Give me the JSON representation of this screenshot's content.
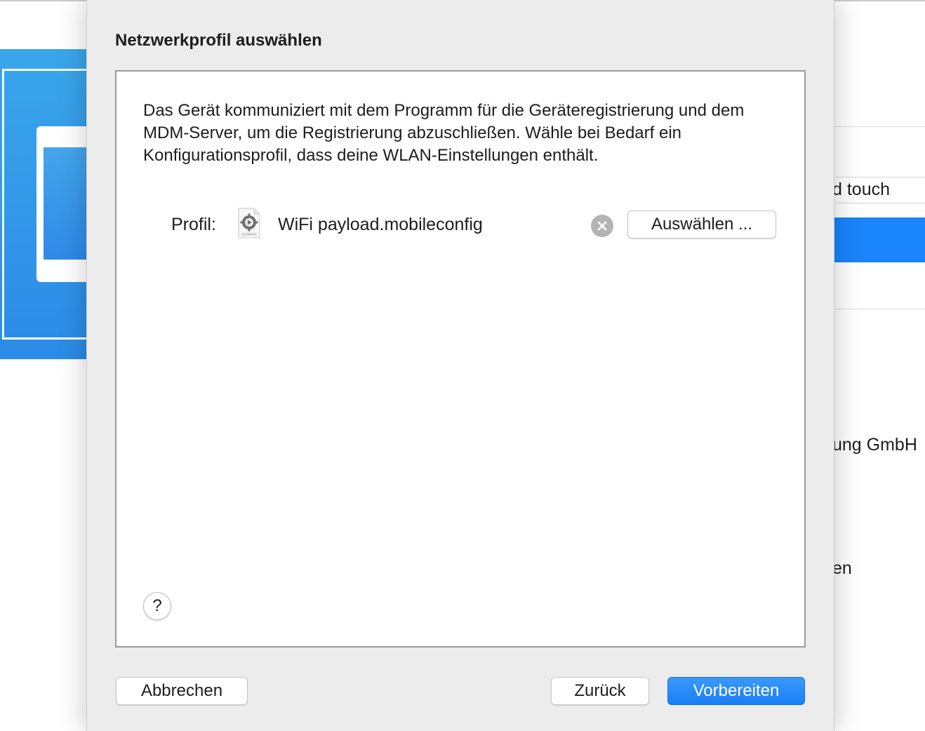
{
  "background": {
    "fragment_1": "d touch",
    "fragment_2": "ung GmbH",
    "fragment_3": "en"
  },
  "sheet": {
    "title": "Netzwerkprofil auswählen",
    "description": "Das Gerät kommuniziert mit dem Programm für die Geräteregistrierung und dem MDM-Server, um die Registrierung abzuschließen. Wähle bei Bedarf ein Konfigurationsprofil, dass deine WLAN-Einstellungen enthält.",
    "profile": {
      "label": "Profil:",
      "icon_text": "CONFIG",
      "filename": "WiFi payload.mobileconfig",
      "select_label": "Auswählen ..."
    },
    "help_label": "?",
    "buttons": {
      "cancel": "Abbrechen",
      "back": "Zurück",
      "prepare": "Vorbereiten"
    }
  },
  "colors": {
    "accent": "#1a84fb",
    "sheet_bg": "#ececec"
  }
}
